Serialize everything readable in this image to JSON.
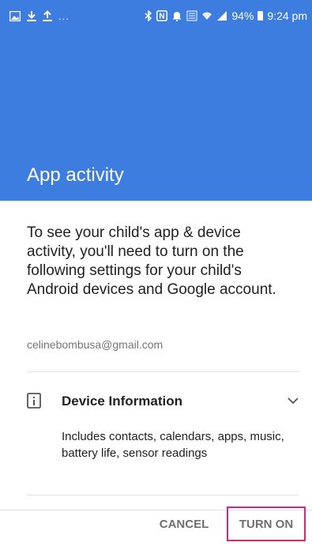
{
  "status_bar": {
    "left_icons": [
      "gallery-icon",
      "download-icon",
      "upload-icon"
    ],
    "dots": "...",
    "right_icons": [
      "bluetooth-icon",
      "nfc-icon",
      "notification-icon",
      "volte-icon",
      "wifi-icon",
      "signal-icon"
    ],
    "battery": "94%",
    "time": "9:24 pm"
  },
  "header": {
    "title": "App activity"
  },
  "content": {
    "description": "To see your child's app & device activity, you'll need to turn on the following settings for your child's Android devices and Google account.",
    "email": "celinebombusa@gmail.com",
    "device_info": {
      "label": "Device Information",
      "icon": "device-info-icon",
      "description": "Includes contacts, calendars, apps, music, battery life, sensor readings"
    }
  },
  "actions": {
    "cancel": "CANCEL",
    "turn_on": "TURN ON"
  },
  "colors": {
    "header": "#3d7ddf",
    "highlight_border": "#e4217a",
    "button_text": "#6f6f6f"
  }
}
